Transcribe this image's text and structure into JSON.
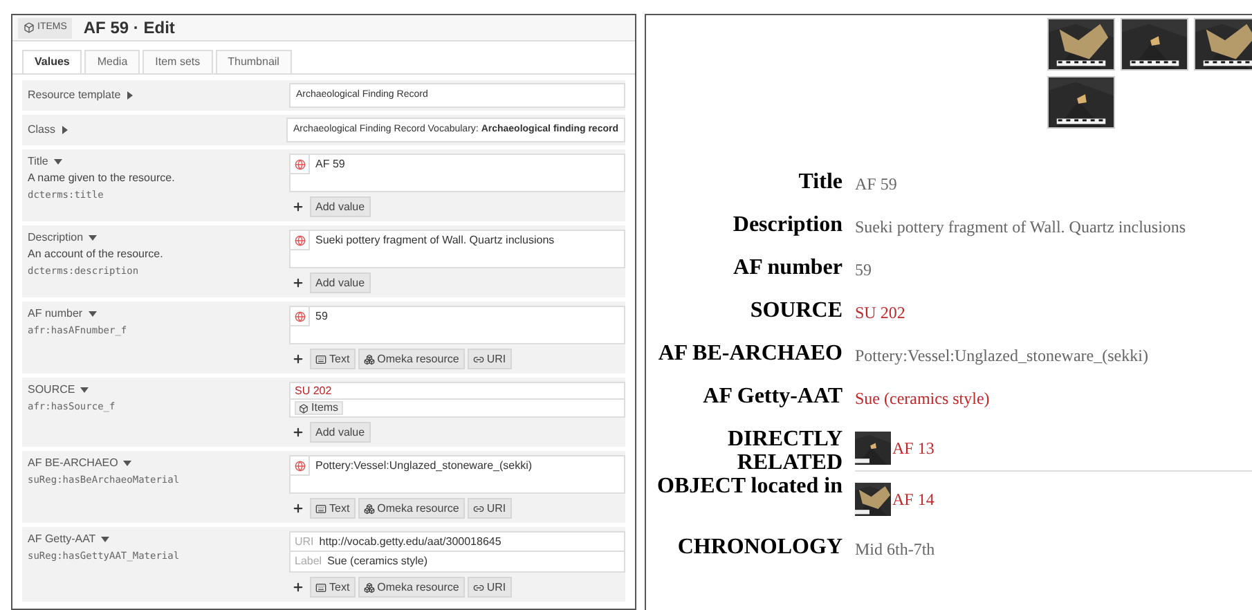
{
  "editor": {
    "section": "ITEMS",
    "title": "AF 59 · Edit",
    "tabs": [
      {
        "label": "Values",
        "selected": true
      },
      {
        "label": "Media",
        "selected": false
      },
      {
        "label": "Item sets",
        "selected": false
      },
      {
        "label": "Thumbnail",
        "selected": false
      }
    ],
    "fields": [
      {
        "kind": "select",
        "label": "Resource template",
        "expanded": false,
        "value": "Archaeological Finding Record"
      },
      {
        "kind": "select",
        "label": "Class",
        "expanded": false,
        "value": "Archaeological Finding Record Vocabulary: **Archaeological finding record**"
      },
      {
        "kind": "property",
        "label": "Title",
        "expanded": true,
        "description": "A name given to the resource.",
        "term": "dcterms:title",
        "values": [
          {
            "kind": "literal",
            "text": "AF 59"
          }
        ],
        "actions": [
          {
            "kind": "add",
            "label": "Add value"
          }
        ]
      },
      {
        "kind": "property",
        "label": "Description",
        "expanded": true,
        "description": "An account of the resource.",
        "term": "dcterms:description",
        "values": [
          {
            "kind": "literal",
            "text": "Sueki pottery fragment of Wall. Quartz inclusions"
          }
        ],
        "actions": [
          {
            "kind": "add",
            "label": "Add value"
          }
        ]
      },
      {
        "kind": "property",
        "label": "AF number",
        "expanded": true,
        "term": "afr:hasAFnumber_f",
        "values": [
          {
            "kind": "literal",
            "text": "59"
          }
        ],
        "actions": [
          {
            "kind": "text",
            "label": "Text"
          },
          {
            "kind": "resource",
            "label": "Omeka resource"
          },
          {
            "kind": "uri",
            "label": "URI"
          }
        ]
      },
      {
        "kind": "property",
        "label": "SOURCE",
        "expanded": true,
        "term": "afr:hasSource_f",
        "values": [
          {
            "kind": "resource",
            "text": "SU 202",
            "chip": "Items"
          }
        ],
        "actions": [
          {
            "kind": "add",
            "label": "Add value"
          }
        ]
      },
      {
        "kind": "property",
        "label": "AF BE-ARCHAEO",
        "expanded": true,
        "term": "suReg:hasBeArchaeoMaterial",
        "values": [
          {
            "kind": "literal",
            "text": "Pottery:Vessel:Unglazed_stoneware_(sekki)"
          }
        ],
        "actions": [
          {
            "kind": "text",
            "label": "Text"
          },
          {
            "kind": "resource",
            "label": "Omeka resource"
          },
          {
            "kind": "uri",
            "label": "URI"
          }
        ]
      },
      {
        "kind": "property",
        "label": "AF Getty-AAT",
        "expanded": true,
        "term": "suReg:hasGettyAAT_Material",
        "values": [
          {
            "kind": "uri",
            "uri_caption": "URI",
            "uri": "http://vocab.getty.edu/aat/300018645",
            "label_caption": "Label",
            "label": "Sue (ceramics style)"
          }
        ],
        "actions": [
          {
            "kind": "text",
            "label": "Text"
          },
          {
            "kind": "resource",
            "label": "Omeka resource"
          },
          {
            "kind": "uri",
            "label": "URI"
          }
        ]
      }
    ]
  },
  "public_view": {
    "properties": [
      {
        "label": "Title",
        "values": [
          {
            "kind": "text",
            "text": "AF 59"
          }
        ]
      },
      {
        "label": "Description",
        "values": [
          {
            "kind": "text",
            "text": "Sueki pottery fragment of Wall. Quartz inclusions"
          }
        ]
      },
      {
        "label": "AF number",
        "values": [
          {
            "kind": "text",
            "text": "59"
          }
        ]
      },
      {
        "label": "SOURCE",
        "values": [
          {
            "kind": "link",
            "text": "SU 202"
          }
        ]
      },
      {
        "label": "AF BE-ARCHAEO",
        "values": [
          {
            "kind": "text",
            "text": "Pottery:Vessel:Unglazed_stoneware_(sekki)"
          }
        ]
      },
      {
        "label": "AF Getty-AAT",
        "values": [
          {
            "kind": "link",
            "text": "Sue (ceramics style)"
          }
        ]
      },
      {
        "label": "DIRECTLY RELATED OBJECT located in",
        "values": [
          {
            "kind": "item",
            "text": "AF 13"
          },
          {
            "kind": "item",
            "text": "AF 14"
          }
        ]
      },
      {
        "label": "CHRONOLOGY",
        "values": [
          {
            "kind": "text",
            "text": "Mid 6th-7th"
          }
        ]
      }
    ]
  }
}
